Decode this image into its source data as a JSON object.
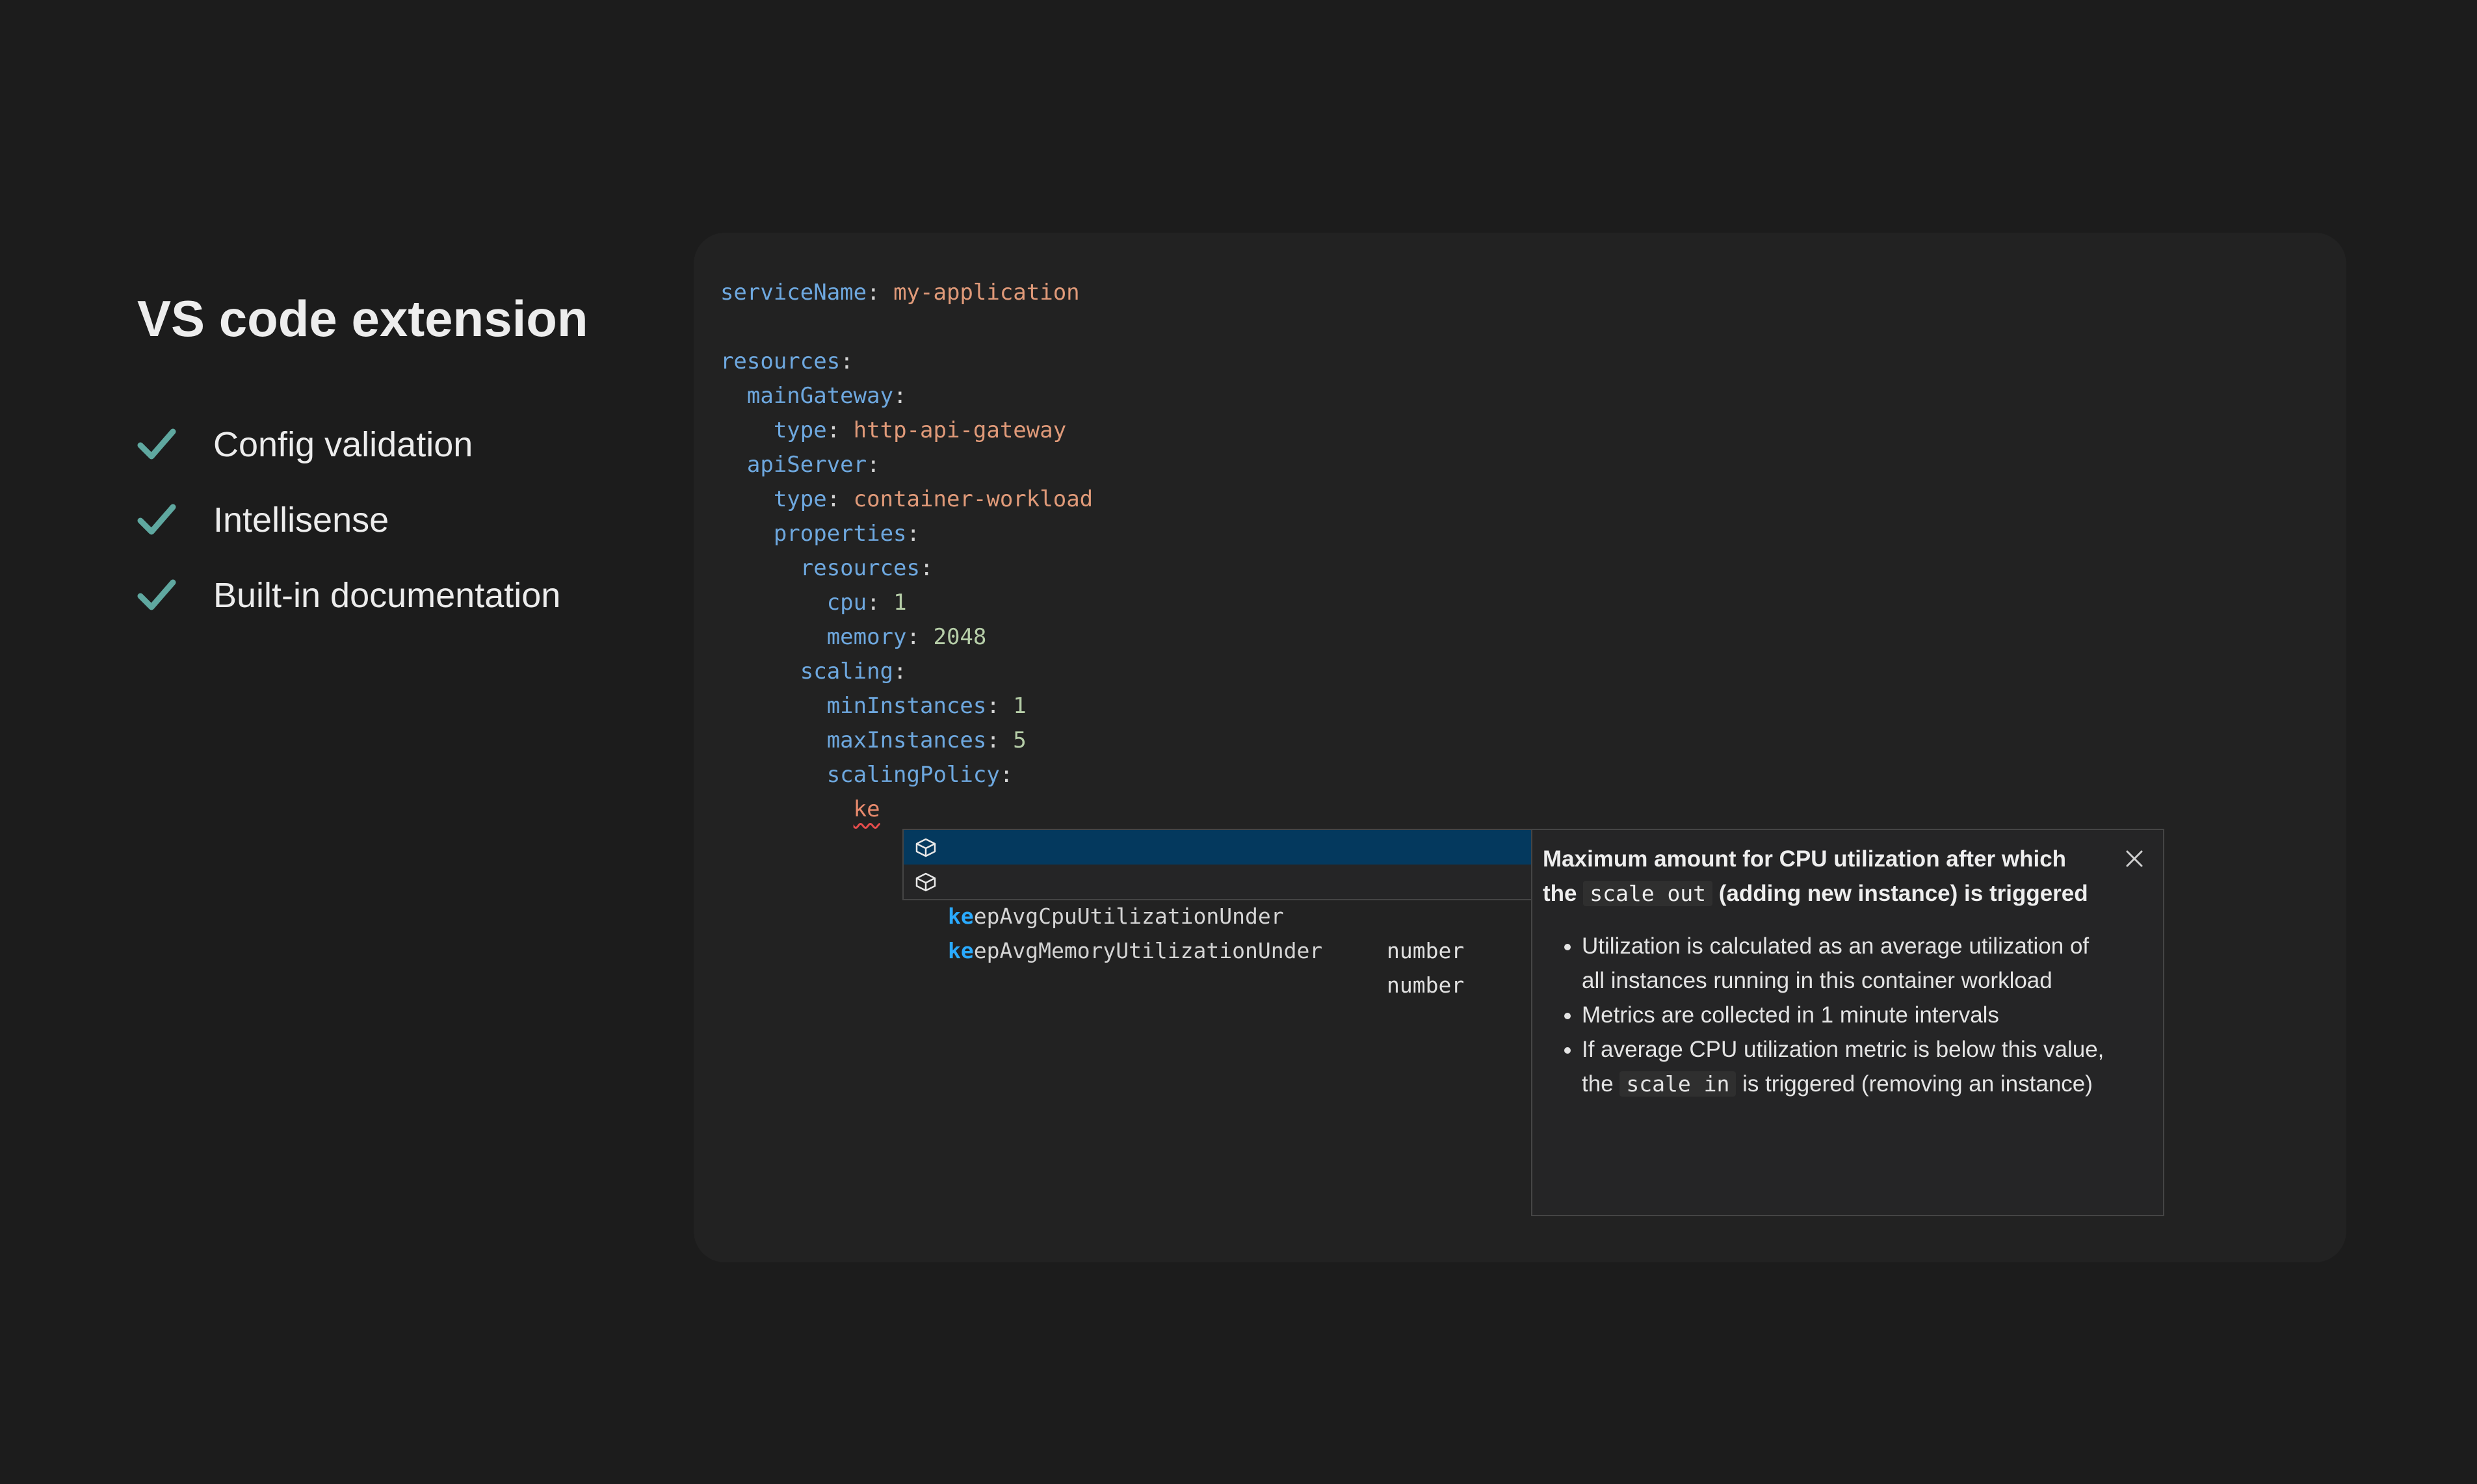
{
  "slide": {
    "title": "VS code extension",
    "check_color": "#5fa8a0",
    "features": [
      {
        "label": "Config validation",
        "icon": "check-icon"
      },
      {
        "label": "Intellisense",
        "icon": "check-icon"
      },
      {
        "label": "Built-in documentation",
        "icon": "check-icon"
      }
    ]
  },
  "editor": {
    "lines": [
      {
        "indent": "  ",
        "key": "serviceName",
        "colon": ":",
        "value": " my-application",
        "value_type": "str"
      },
      {
        "indent": "",
        "key": "",
        "colon": "",
        "value": "",
        "value_type": ""
      },
      {
        "indent": "  ",
        "key": "resources",
        "colon": ":",
        "value": "",
        "value_type": ""
      },
      {
        "indent": "    ",
        "key": "mainGateway",
        "colon": ":",
        "value": "",
        "value_type": ""
      },
      {
        "indent": "      ",
        "key": "type",
        "colon": ":",
        "value": " http-api-gateway",
        "value_type": "str"
      },
      {
        "indent": "    ",
        "key": "apiServer",
        "colon": ":",
        "value": "",
        "value_type": ""
      },
      {
        "indent": "      ",
        "key": "type",
        "colon": ":",
        "value": " container-workload",
        "value_type": "str"
      },
      {
        "indent": "      ",
        "key": "properties",
        "colon": ":",
        "value": "",
        "value_type": ""
      },
      {
        "indent": "        ",
        "key": "resources",
        "colon": ":",
        "value": "",
        "value_type": ""
      },
      {
        "indent": "          ",
        "key": "cpu",
        "colon": ":",
        "value": " 1",
        "value_type": "num"
      },
      {
        "indent": "          ",
        "key": "memory",
        "colon": ":",
        "value": " 2048",
        "value_type": "num"
      },
      {
        "indent": "        ",
        "key": "scaling",
        "colon": ":",
        "value": "",
        "value_type": ""
      },
      {
        "indent": "          ",
        "key": "minInstances",
        "colon": ":",
        "value": " 1",
        "value_type": "num"
      },
      {
        "indent": "          ",
        "key": "maxInstances",
        "colon": ":",
        "value": " 5",
        "value_type": "num"
      },
      {
        "indent": "          ",
        "key": "scalingPolicy",
        "colon": ":",
        "value": "",
        "value_type": ""
      },
      {
        "indent": "            ",
        "key": "",
        "colon": "",
        "value": "ke",
        "value_type": "err"
      }
    ]
  },
  "suggest": {
    "items": [
      {
        "match": "ke",
        "rest": "epAvgCpuUtilizationUnder",
        "detail": "number",
        "icon": "property-icon",
        "selected": true
      },
      {
        "match": "ke",
        "rest": "epAvgMemoryUtilizationUnder",
        "detail": "number",
        "icon": "property-icon",
        "selected": false
      }
    ]
  },
  "docs": {
    "title_pre": "Maximum amount for CPU utilization after which the ",
    "title_code": "scale out",
    "title_post": " (adding new instance) is triggered",
    "bullet1": "Utilization is calculated as an average utilization of all instances running in this container workload",
    "bullet2": "Metrics are collected in 1 minute intervals",
    "bullet3_pre": "If average CPU utilization metric is below this value, the ",
    "bullet3_code": "scale in",
    "bullet3_post": " is triggered (removing an instance)",
    "close_icon": "close-icon"
  }
}
